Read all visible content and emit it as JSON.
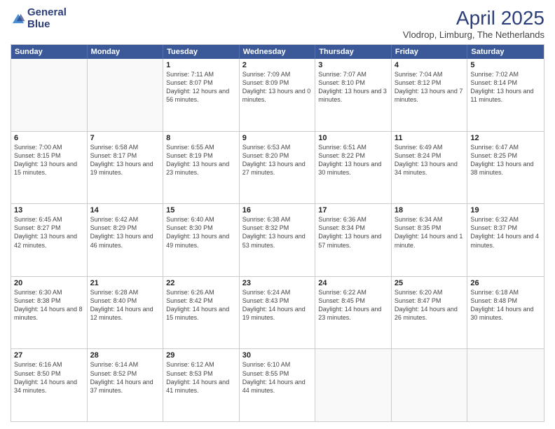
{
  "logo": {
    "line1": "General",
    "line2": "Blue"
  },
  "title": "April 2025",
  "subtitle": "Vlodrop, Limburg, The Netherlands",
  "columns": [
    "Sunday",
    "Monday",
    "Tuesday",
    "Wednesday",
    "Thursday",
    "Friday",
    "Saturday"
  ],
  "weeks": [
    [
      {
        "day": "",
        "info": ""
      },
      {
        "day": "",
        "info": ""
      },
      {
        "day": "1",
        "info": "Sunrise: 7:11 AM\nSunset: 8:07 PM\nDaylight: 12 hours and 56 minutes."
      },
      {
        "day": "2",
        "info": "Sunrise: 7:09 AM\nSunset: 8:09 PM\nDaylight: 13 hours and 0 minutes."
      },
      {
        "day": "3",
        "info": "Sunrise: 7:07 AM\nSunset: 8:10 PM\nDaylight: 13 hours and 3 minutes."
      },
      {
        "day": "4",
        "info": "Sunrise: 7:04 AM\nSunset: 8:12 PM\nDaylight: 13 hours and 7 minutes."
      },
      {
        "day": "5",
        "info": "Sunrise: 7:02 AM\nSunset: 8:14 PM\nDaylight: 13 hours and 11 minutes."
      }
    ],
    [
      {
        "day": "6",
        "info": "Sunrise: 7:00 AM\nSunset: 8:15 PM\nDaylight: 13 hours and 15 minutes."
      },
      {
        "day": "7",
        "info": "Sunrise: 6:58 AM\nSunset: 8:17 PM\nDaylight: 13 hours and 19 minutes."
      },
      {
        "day": "8",
        "info": "Sunrise: 6:55 AM\nSunset: 8:19 PM\nDaylight: 13 hours and 23 minutes."
      },
      {
        "day": "9",
        "info": "Sunrise: 6:53 AM\nSunset: 8:20 PM\nDaylight: 13 hours and 27 minutes."
      },
      {
        "day": "10",
        "info": "Sunrise: 6:51 AM\nSunset: 8:22 PM\nDaylight: 13 hours and 30 minutes."
      },
      {
        "day": "11",
        "info": "Sunrise: 6:49 AM\nSunset: 8:24 PM\nDaylight: 13 hours and 34 minutes."
      },
      {
        "day": "12",
        "info": "Sunrise: 6:47 AM\nSunset: 8:25 PM\nDaylight: 13 hours and 38 minutes."
      }
    ],
    [
      {
        "day": "13",
        "info": "Sunrise: 6:45 AM\nSunset: 8:27 PM\nDaylight: 13 hours and 42 minutes."
      },
      {
        "day": "14",
        "info": "Sunrise: 6:42 AM\nSunset: 8:29 PM\nDaylight: 13 hours and 46 minutes."
      },
      {
        "day": "15",
        "info": "Sunrise: 6:40 AM\nSunset: 8:30 PM\nDaylight: 13 hours and 49 minutes."
      },
      {
        "day": "16",
        "info": "Sunrise: 6:38 AM\nSunset: 8:32 PM\nDaylight: 13 hours and 53 minutes."
      },
      {
        "day": "17",
        "info": "Sunrise: 6:36 AM\nSunset: 8:34 PM\nDaylight: 13 hours and 57 minutes."
      },
      {
        "day": "18",
        "info": "Sunrise: 6:34 AM\nSunset: 8:35 PM\nDaylight: 14 hours and 1 minute."
      },
      {
        "day": "19",
        "info": "Sunrise: 6:32 AM\nSunset: 8:37 PM\nDaylight: 14 hours and 4 minutes."
      }
    ],
    [
      {
        "day": "20",
        "info": "Sunrise: 6:30 AM\nSunset: 8:38 PM\nDaylight: 14 hours and 8 minutes."
      },
      {
        "day": "21",
        "info": "Sunrise: 6:28 AM\nSunset: 8:40 PM\nDaylight: 14 hours and 12 minutes."
      },
      {
        "day": "22",
        "info": "Sunrise: 6:26 AM\nSunset: 8:42 PM\nDaylight: 14 hours and 15 minutes."
      },
      {
        "day": "23",
        "info": "Sunrise: 6:24 AM\nSunset: 8:43 PM\nDaylight: 14 hours and 19 minutes."
      },
      {
        "day": "24",
        "info": "Sunrise: 6:22 AM\nSunset: 8:45 PM\nDaylight: 14 hours and 23 minutes."
      },
      {
        "day": "25",
        "info": "Sunrise: 6:20 AM\nSunset: 8:47 PM\nDaylight: 14 hours and 26 minutes."
      },
      {
        "day": "26",
        "info": "Sunrise: 6:18 AM\nSunset: 8:48 PM\nDaylight: 14 hours and 30 minutes."
      }
    ],
    [
      {
        "day": "27",
        "info": "Sunrise: 6:16 AM\nSunset: 8:50 PM\nDaylight: 14 hours and 34 minutes."
      },
      {
        "day": "28",
        "info": "Sunrise: 6:14 AM\nSunset: 8:52 PM\nDaylight: 14 hours and 37 minutes."
      },
      {
        "day": "29",
        "info": "Sunrise: 6:12 AM\nSunset: 8:53 PM\nDaylight: 14 hours and 41 minutes."
      },
      {
        "day": "30",
        "info": "Sunrise: 6:10 AM\nSunset: 8:55 PM\nDaylight: 14 hours and 44 minutes."
      },
      {
        "day": "",
        "info": ""
      },
      {
        "day": "",
        "info": ""
      },
      {
        "day": "",
        "info": ""
      }
    ]
  ]
}
